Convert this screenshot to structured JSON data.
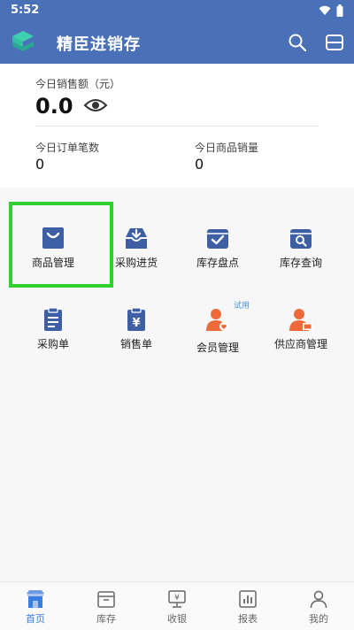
{
  "status_bar": {
    "time": "5:52"
  },
  "app_bar": {
    "title": "精臣进销存"
  },
  "stats": {
    "sales_label": "今日销售额（元）",
    "sales_value": "0.0",
    "orders_label": "今日订单笔数",
    "orders_value": "0",
    "items_label": "今日商品销量",
    "items_value": "0"
  },
  "grid": {
    "items": [
      {
        "label": "商品管理"
      },
      {
        "label": "采购进货"
      },
      {
        "label": "库存盘点"
      },
      {
        "label": "库存查询"
      },
      {
        "label": "采购单"
      },
      {
        "label": "销售单"
      },
      {
        "label": "会员管理",
        "badge": "试用"
      },
      {
        "label": "供应商管理"
      }
    ]
  },
  "bottom_nav": {
    "items": [
      {
        "label": "首页",
        "icon": "home-icon",
        "active": true
      },
      {
        "label": "库存",
        "icon": "inventory-icon"
      },
      {
        "label": "收银",
        "icon": "cashier-icon"
      },
      {
        "label": "报表",
        "icon": "report-icon"
      },
      {
        "label": "我的",
        "icon": "profile-icon"
      }
    ]
  },
  "colors": {
    "primary": "#4a70b8",
    "icon_blue": "#3f5fa5",
    "icon_orange": "#ef6a3a",
    "highlight": "#2fd02f",
    "active_nav": "#3a7de0"
  }
}
